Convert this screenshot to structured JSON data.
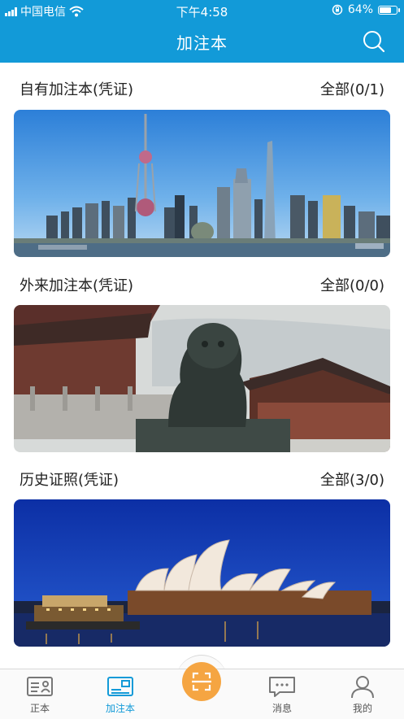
{
  "status_bar": {
    "carrier": "中国电信",
    "time": "下午4:58",
    "battery_percent": "64%",
    "battery_level": 0.64,
    "icons": [
      "signal-icon",
      "wifi-icon",
      "orientation-lock-icon",
      "battery-icon"
    ]
  },
  "header": {
    "title": "加注本",
    "search_icon": "search-icon"
  },
  "sections": [
    {
      "title": "自有加注本(凭证)",
      "count": "全部(0/1)",
      "image": "shanghai-skyline"
    },
    {
      "title": "外来加注本(凭证)",
      "count": "全部(0/0)",
      "image": "forbidden-city-lion"
    },
    {
      "title": "历史证照(凭证)",
      "count": "全部(3/0)",
      "image": "sydney-opera-house"
    }
  ],
  "tab_bar": {
    "active": "加注本",
    "tabs": [
      {
        "label": "正本",
        "icon": "id-card-icon"
      },
      {
        "label": "加注本",
        "icon": "card-book-icon"
      },
      {
        "label": "",
        "icon": "scan-icon"
      },
      {
        "label": "消息",
        "icon": "message-icon"
      },
      {
        "label": "我的",
        "icon": "user-icon"
      }
    ]
  },
  "colors": {
    "primary": "#129ad8",
    "scan_button": "#f5a542",
    "background": "#ffffff"
  }
}
